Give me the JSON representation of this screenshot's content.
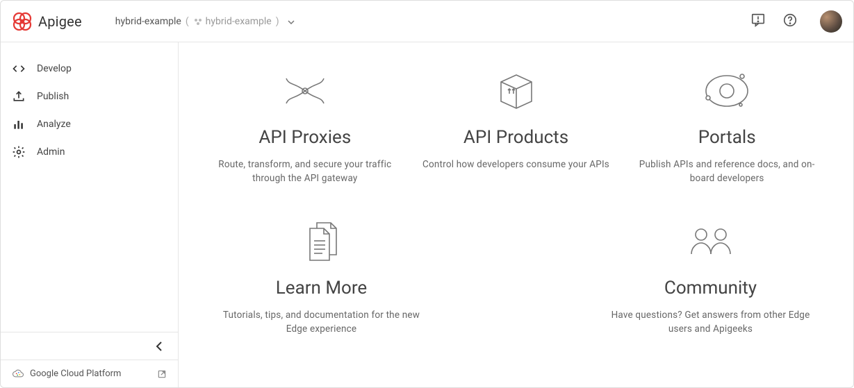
{
  "header": {
    "brand": "Apigee",
    "org_name": "hybrid-example",
    "org_inner": "hybrid-example"
  },
  "sidebar": {
    "items": [
      {
        "label": "Develop"
      },
      {
        "label": "Publish"
      },
      {
        "label": "Analyze"
      },
      {
        "label": "Admin"
      }
    ],
    "footer_link": "Google Cloud Platform"
  },
  "cards": {
    "api_proxies": {
      "title": "API Proxies",
      "desc": "Route, transform, and secure your traffic through the API gateway"
    },
    "api_products": {
      "title": "API Products",
      "desc": "Control how developers consume your APIs"
    },
    "portals": {
      "title": "Portals",
      "desc": "Publish APIs and reference docs, and on-board developers"
    },
    "learn_more": {
      "title": "Learn More",
      "desc": "Tutorials, tips, and documentation for the new Edge experience"
    },
    "community": {
      "title": "Community",
      "desc": "Have questions? Get answers from other Edge users and Apigeeks"
    }
  }
}
